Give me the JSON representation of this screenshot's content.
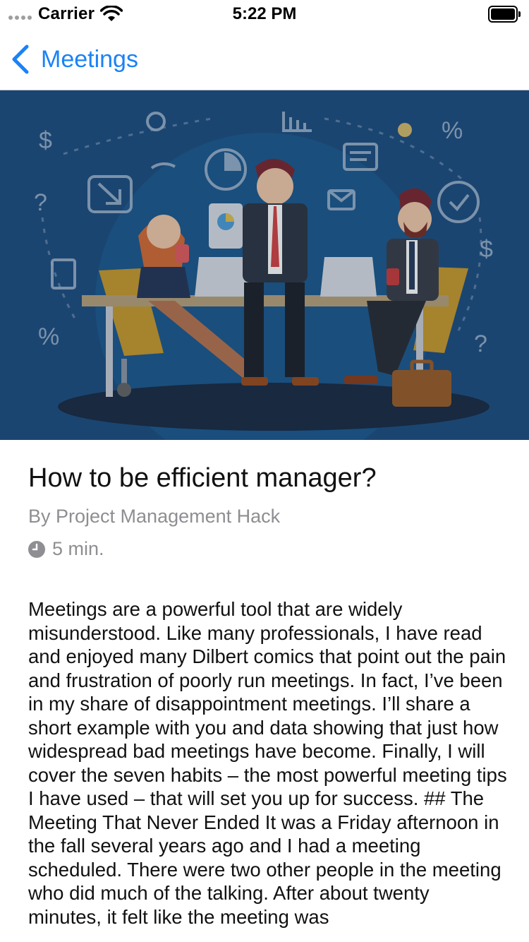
{
  "status_bar": {
    "carrier": "Carrier",
    "time": "5:22 PM"
  },
  "nav": {
    "back_label": "Meetings",
    "accent_color": "#1a82f7"
  },
  "hero": {
    "icon": "team-meeting-illustration"
  },
  "article": {
    "title": "How to be efficient manager?",
    "author": "By Project Management Hack",
    "read_time": "5 min.",
    "body": "Meetings are a powerful tool that are widely misunderstood. Like many professionals, I have read and enjoyed many Dilbert comics that point out the pain and frustration of poorly run meetings. In fact, I’ve been in my share of disappointment meetings. I’ll share a short example with you and data showing that just how widespread bad meetings have become. Finally, I will cover the seven habits – the most powerful meeting tips I have used – that will set you up for success.  ## The Meeting That Never Ended  It was a Friday afternoon in the fall several years ago and I had a meeting scheduled. There were two other people in the meeting who did much of the talking. After about twenty minutes, it felt like the meeting was"
  }
}
